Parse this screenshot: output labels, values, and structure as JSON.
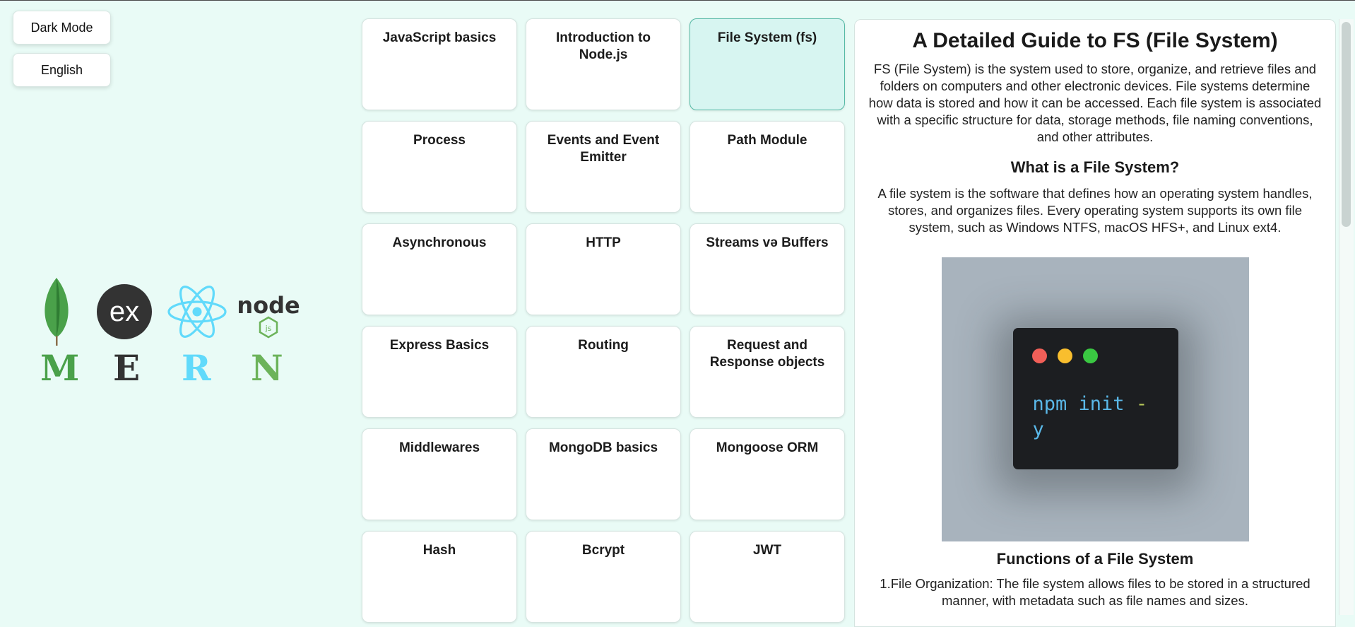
{
  "controls": {
    "dark_mode_label": "Dark Mode",
    "language_label": "English"
  },
  "logo": {
    "letters": [
      "M",
      "E",
      "R",
      "N"
    ],
    "express_text": "ex",
    "node_text": "node",
    "node_js_text": "js",
    "colors": {
      "mongo": "#4aa14a",
      "express": "#333333",
      "react": "#61dafb",
      "node": "#6cb35a"
    }
  },
  "topics": [
    "JavaScript basics",
    "Introduction to Node.js",
    "File System (fs)",
    "Process",
    "Events and Event Emitter",
    "Path Module",
    "Asynchronous",
    "HTTP",
    "Streams və Buffers",
    "Express Basics",
    "Routing",
    "Request and Response objects",
    "Middlewares",
    "MongoDB basics",
    "Mongoose ORM",
    "Hash",
    "Bcrypt",
    "JWT"
  ],
  "active_topic": "File System (fs)",
  "article": {
    "title": "A Detailed Guide to FS (File System)",
    "intro": "FS (File System) is the system used to store, organize, and retrieve files and folders on computers and other electronic devices. File systems determine how data is stored and how it can be accessed. Each file system is associated with a specific structure for data, storage methods, file naming conventions, and other attributes.",
    "section1_title": "What is a File System?",
    "section1_text": "A file system is the software that defines how an operating system handles, stores, and organizes files. Every operating system supports its own file system, such as Windows NTFS, macOS HFS+, and Linux ext4.",
    "terminal_command": "npm init",
    "terminal_flag": "-",
    "terminal_flag_cont": "y",
    "section2_title": "Functions of a File System",
    "section2_text": "1.File Organization: The file system allows files to be stored in a structured manner, with metadata such as file names and sizes."
  },
  "colors": {
    "background": "#e9fbf6",
    "active_card": "#d7f5f1",
    "active_border": "#55b9a5"
  }
}
